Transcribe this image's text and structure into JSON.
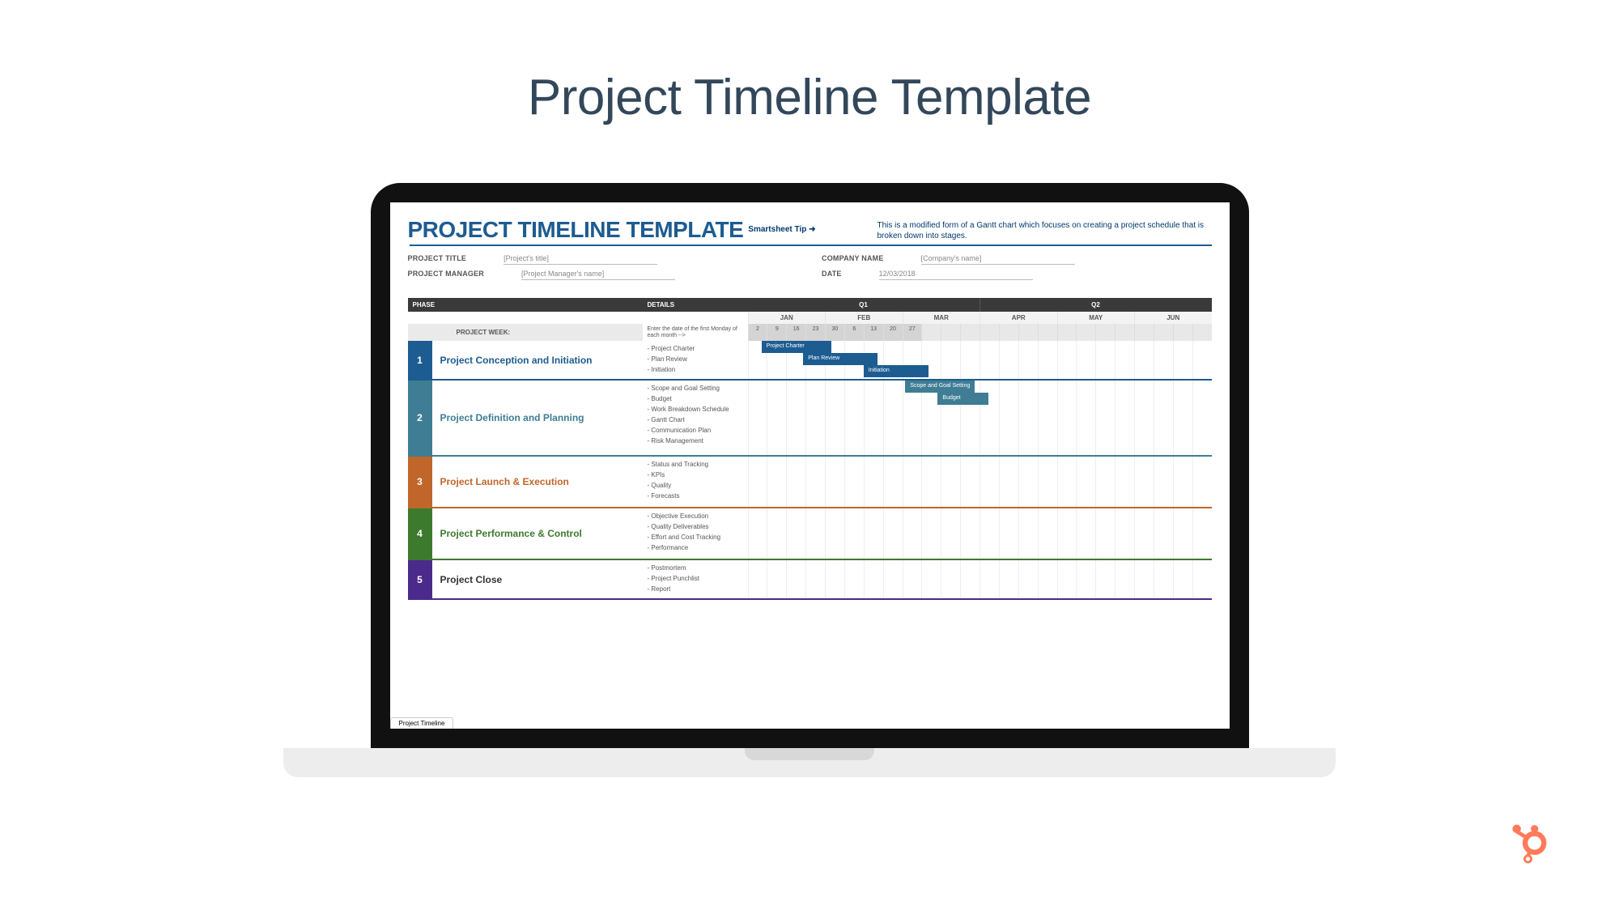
{
  "hero": {
    "title": "Project Timeline Template"
  },
  "sheet": {
    "title": "PROJECT TIMELINE TEMPLATE",
    "tip_label": "Smartsheet Tip ➜",
    "tip_text": "This is a modified form of a Gantt chart which focuses on creating a project schedule that is broken down into stages."
  },
  "meta": {
    "project_title_label": "PROJECT TITLE",
    "project_title_value": "[Project's title]",
    "company_label": "COMPANY NAME",
    "company_value": "[Company's name]",
    "pm_label": "PROJECT MANAGER",
    "pm_value": "[Project Manager's name]",
    "date_label": "DATE",
    "date_value": "12/03/2018"
  },
  "columns": {
    "phase": "PHASE",
    "details": "DETAILS",
    "q1": "Q1",
    "q2": "Q2"
  },
  "months": [
    "JAN",
    "FEB",
    "MAR",
    "APR",
    "MAY",
    "JUN"
  ],
  "project_week_label": "PROJECT WEEK:",
  "project_week_hint": "Enter the date of the first Monday of each month -->",
  "weeks": [
    "2",
    "9",
    "16",
    "23",
    "30",
    "6",
    "13",
    "20",
    "27"
  ],
  "phases": [
    {
      "num": "1",
      "name": "Project Conception and Initiation",
      "color": "#1d5c91",
      "num_bg": "#1d5c91",
      "name_color": "#1d5c91",
      "details": [
        "- Project Charter",
        "- Plan Review",
        "- Initiation"
      ]
    },
    {
      "num": "2",
      "name": "Project Definition and Planning",
      "color": "#3f7d94",
      "num_bg": "#3f7d94",
      "name_color": "#3f7d94",
      "details": [
        "- Scope and Goal Setting",
        "- Budget",
        "- Work Breakdown Schedule",
        "- Gantt Chart",
        "- Communication Plan",
        "- Risk Management"
      ]
    },
    {
      "num": "3",
      "name": "Project Launch & Execution",
      "color": "#c0662a",
      "num_bg": "#c0662a",
      "name_color": "#c0662a",
      "details": [
        "- Status and Tracking",
        "- KPIs",
        "- Quality",
        "- Forecasts"
      ]
    },
    {
      "num": "4",
      "name": "Project Performance & Control",
      "color": "#3c7a2d",
      "num_bg": "#3c7a2d",
      "name_color": "#3c7a2d",
      "details": [
        "- Objective Execution",
        "- Quality Deliverables",
        "- Effort and Cost Tracking",
        "- Performance"
      ]
    },
    {
      "num": "5",
      "name": "Project Close",
      "color": "#4a2a8a",
      "num_bg": "#4a2a8a",
      "name_color": "#333",
      "details": [
        "- Postmortem",
        "- Project Punchlist",
        "- Report"
      ]
    }
  ],
  "bars": [
    {
      "phase": 0,
      "row": 0,
      "left_pct": 3,
      "width_pct": 15,
      "label": "Project Charter",
      "color": "#1d5c91"
    },
    {
      "phase": 0,
      "row": 1,
      "left_pct": 12,
      "width_pct": 16,
      "label": "Plan Review",
      "color": "#1d5c91"
    },
    {
      "phase": 0,
      "row": 2,
      "left_pct": 25,
      "width_pct": 14,
      "label": "Initiation",
      "color": "#1d5c91"
    },
    {
      "phase": 1,
      "row": 0,
      "left_pct": 34,
      "width_pct": 15,
      "label": "Scope and Goal Setting",
      "color": "#3f7d94"
    },
    {
      "phase": 1,
      "row": 1,
      "left_pct": 41,
      "width_pct": 11,
      "label": "Budget",
      "color": "#3f7d94"
    }
  ],
  "sheet_tab": "Project Timeline"
}
